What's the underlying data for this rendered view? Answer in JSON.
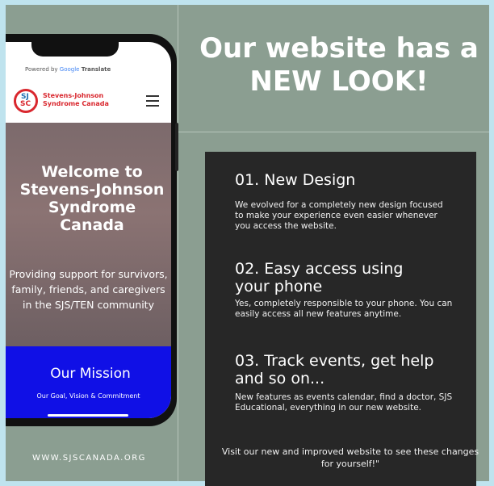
{
  "headline": {
    "line1": "Our website has a",
    "line2": "NEW LOOK!"
  },
  "phone": {
    "translate_prefix": "Powered by ",
    "translate_brand": "Google",
    "translate_label": "Translate",
    "logo_text_top": "SJ",
    "logo_text_bottom": "SC",
    "org_line1": "Stevens-Johnson",
    "org_line2": "Syndrome Canada",
    "menu_icon": "hamburger-icon",
    "hero_title": "Welcome to Stevens-Johnson Syndrome Canada",
    "hero_subtitle": "Providing support for survivors, family, friends, and caregivers in the SJS/TEN community",
    "mission_title": "Our Mission",
    "mission_subtitle": "Our Goal, Vision & Commitment"
  },
  "website_url": "WWW.SJSCANADA.ORG",
  "features": [
    {
      "title": "01. New Design",
      "description": "We evolved for a completely new design focused to make your experience even easier whenever you access the website."
    },
    {
      "title": "02. Easy access using your phone",
      "description": "Yes, completely responsible to your phone. You can easily access all new features anytime."
    },
    {
      "title": "03. Track events, get help and so on...",
      "description": "New features as events calendar, find a doctor, SJS Educational, everything in our new website."
    }
  ],
  "closing_note": "Visit our new and improved website to see these changes for yourself!\"",
  "colors": {
    "background": "#8b9e91",
    "border": "#bfe3ee",
    "panel": "#272727",
    "mission_blue": "#1010e6",
    "brand_red": "#d9272e"
  }
}
